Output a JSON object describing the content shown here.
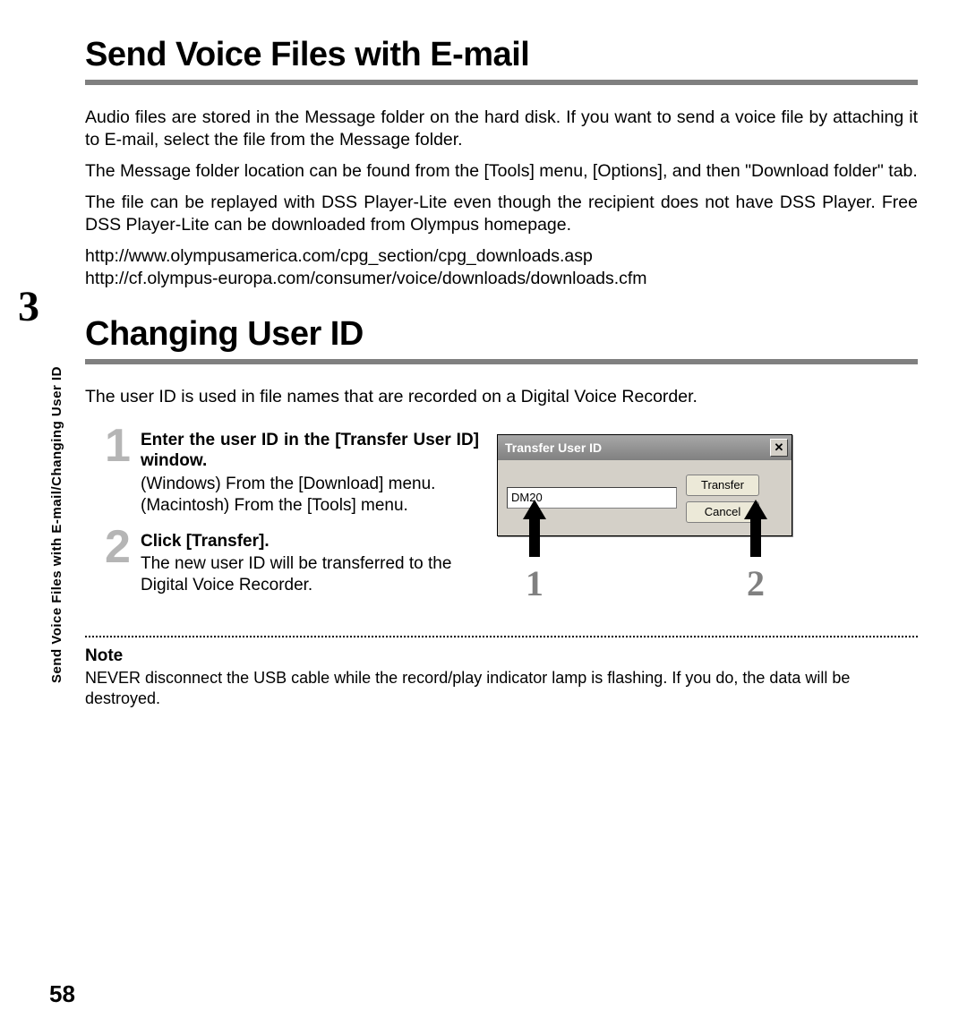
{
  "chapter_number": "3",
  "vertical_label": "Send Voice Files with E-mail/Changing User ID",
  "page_number": "58",
  "section1": {
    "title": "Send Voice Files with E-mail",
    "para1": "Audio files are stored in the Message folder on the hard disk. If you want to send a voice file by attaching it to E-mail, select the file from the Message folder.",
    "para2": "The Message folder location can be found from the [Tools] menu, [Options], and then \"Download folder\" tab.",
    "para3": "The file can be replayed with DSS Player-Lite even though the recipient does not have DSS Player. Free DSS Player-Lite can be downloaded from Olympus homepage.",
    "url1": "http://www.olympusamerica.com/cpg_section/cpg_downloads.asp",
    "url2": "http://cf.olympus-europa.com/consumer/voice/downloads/downloads.cfm"
  },
  "section2": {
    "title": "Changing User ID",
    "intro": "The user ID is used in file names that are recorded on a Digital Voice Recorder.",
    "steps": [
      {
        "num": "1",
        "head": "Enter the user ID in the [Transfer User ID] window.",
        "body1": "(Windows) From the [Download] menu.",
        "body2": "(Macintosh) From the [Tools] menu."
      },
      {
        "num": "2",
        "head": "Click [Transfer].",
        "body1": "The new user ID will be transferred to the Digital Voice Recorder.",
        "body2": ""
      }
    ],
    "dialog": {
      "title": "Transfer User ID",
      "input_value": "DM20",
      "btn_transfer": "Transfer",
      "btn_cancel": "Cancel"
    },
    "callouts": {
      "a1": "1",
      "a2": "2"
    },
    "note_head": "Note",
    "note_body": "NEVER disconnect the USB cable while the record/play indicator lamp is flashing. If you do, the data will be destroyed."
  }
}
